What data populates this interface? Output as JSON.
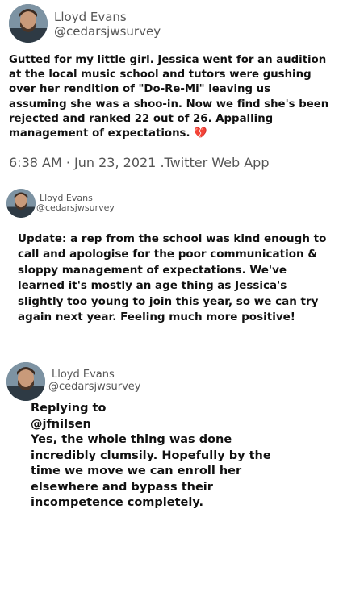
{
  "tweets": [
    {
      "author": {
        "name": "Lloyd Evans",
        "handle": "@cedarsjwsurvey",
        "avatar_icon": "profile-photo"
      },
      "text": "Gutted for my little girl. Jessica went for an audition at the local music school and tutors were gushing over her rendition of \"Do-Re-Mi\" leaving us assuming she was a shoo-in. Now we find she's been rejected and ranked 22 out of 26. Appalling management of expectations.",
      "emoji": "💔",
      "timestamp": "6:38 AM · Jun 23, 2021 .Twitter Web App"
    },
    {
      "author": {
        "name": "Lloyd Evans",
        "handle": "@cedarsjwsurvey",
        "avatar_icon": "profile-photo"
      },
      "text": "Update: a rep from the school was kind enough to call and apologise for the poor communication & sloppy management of expectations. We've learned it's mostly an age thing as Jessica's slightly too young to join this year, so we can try again next year. Feeling much more positive!"
    },
    {
      "author": {
        "name": "Lloyd Evans",
        "handle": "@cedarsjwsurvey",
        "avatar_icon": "profile-photo"
      },
      "replying_label": "Replying to",
      "reply_to": "@jfnilsen",
      "text": "Yes, the whole thing was done incredibly clumsily. Hopefully by the time we move we can enroll her elsewhere and bypass their incompetence completely."
    }
  ],
  "colors": {
    "text": "#111111",
    "secondary": "#555555",
    "emoji": "#c2185b"
  }
}
